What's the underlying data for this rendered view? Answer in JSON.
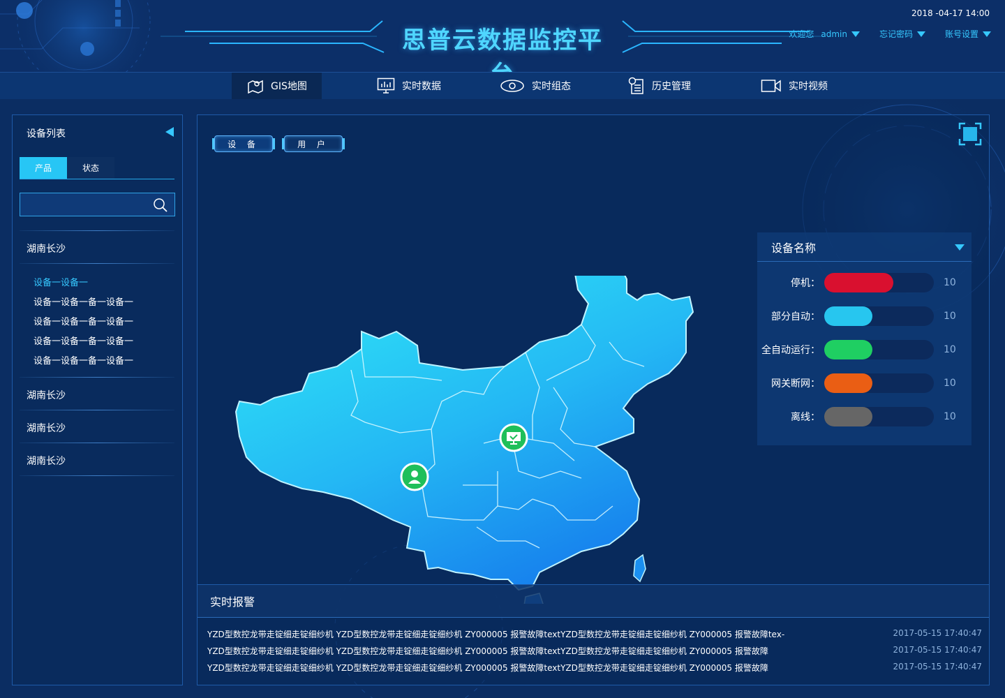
{
  "header": {
    "title": "思普云数据监控平台",
    "datetime": "2018 -04-17 14:00",
    "welcome": "欢迎您",
    "username": "admin",
    "forgot_password": "忘记密码",
    "account_settings": "账号设置"
  },
  "nav": [
    {
      "label": "GIS地图",
      "icon": "map-pin-icon",
      "active": true
    },
    {
      "label": "实时数据",
      "icon": "monitor-chart-icon",
      "active": false
    },
    {
      "label": "实时组态",
      "icon": "eye-icon",
      "active": false
    },
    {
      "label": "历史管理",
      "icon": "document-list-icon",
      "active": false
    },
    {
      "label": "实时视频",
      "icon": "video-camera-icon",
      "active": false
    }
  ],
  "sidebar": {
    "title": "设备列表",
    "tabs": [
      "产品",
      "状态"
    ],
    "search_placeholder": "",
    "groups": [
      {
        "label": "湖南长沙",
        "items": [
          "设备一设备一",
          "设备一设备一备一设备一",
          "设备一设备一备一设备一",
          "设备一设备一备一设备一",
          "设备一设备一备一设备一"
        ]
      },
      {
        "label": "湖南长沙"
      },
      {
        "label": "湖南长沙"
      },
      {
        "label": "湖南长沙"
      }
    ]
  },
  "main": {
    "toggle": [
      "设 备",
      "用 户"
    ],
    "legend": {
      "title": "设备名称",
      "rows": [
        {
          "label": "停机：",
          "value": 10,
          "fill": 0.63,
          "color": "#d9102f"
        },
        {
          "label": "部分自动：",
          "value": 10,
          "fill": 0.44,
          "color": "#27c6ef"
        },
        {
          "label": "全自动运行：",
          "value": 10,
          "fill": 0.44,
          "color": "#1fcf62"
        },
        {
          "label": "网关断网：",
          "value": 10,
          "fill": 0.44,
          "color": "#ea5e14"
        },
        {
          "label": "离线：",
          "value": 10,
          "fill": 0.44,
          "color": "#666666"
        }
      ]
    },
    "map_markers": [
      "monitor-marker-icon",
      "user-marker-icon"
    ],
    "alarm": {
      "title": "实时报警",
      "rows": [
        {
          "text": "YZD型数控龙带走锭细走锭细纱机 YZD型数控龙带走锭细走锭细纱机 ZY000005  报警故障textYZD型数控龙带走锭细走锭细纱机 ZY000005  报警故障tex-",
          "time": "2017-05-15 17:40:47"
        },
        {
          "text": "YZD型数控龙带走锭细走锭细纱机 YZD型数控龙带走锭细走锭细纱机 ZY000005  报警故障textYZD型数控龙带走锭细走锭细纱机 ZY000005  报警故障",
          "time": "2017-05-15 17:40:47"
        },
        {
          "text": "YZD型数控龙带走锭细走锭细纱机 YZD型数控龙带走锭细走锭细纱机 ZY000005  报警故障textYZD型数控龙带走锭细走锭细纱机 ZY000005  报警故障",
          "time": "2017-05-15 17:40:47"
        }
      ]
    }
  },
  "colors": {
    "background": "#0b2d62",
    "accent": "#36c8ff",
    "title": "#4fd6ff",
    "border": "#1e5aa8"
  }
}
